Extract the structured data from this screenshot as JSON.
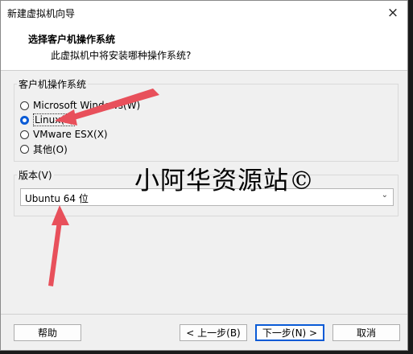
{
  "window": {
    "title": "新建虚拟机向导",
    "close_icon": "×"
  },
  "header": {
    "title": "选择客户机操作系统",
    "subtitle": "此虚拟机中将安装哪种操作系统?"
  },
  "os_group": {
    "label": "客户机操作系统",
    "options": [
      {
        "label": "Microsoft Windows(W)",
        "checked": false
      },
      {
        "label": "Linux(L)",
        "checked": true
      },
      {
        "label": "VMware ESX(X)",
        "checked": false
      },
      {
        "label": "其他(O)",
        "checked": false
      }
    ]
  },
  "version_group": {
    "label": "版本(V)",
    "selected": "Ubuntu 64 位"
  },
  "watermark": "小阿华资源站©",
  "buttons": {
    "help": "帮助",
    "back": "< 上一步(B)",
    "next": "下一步(N) >",
    "cancel": "取消"
  },
  "colors": {
    "accent": "#0a5bd6",
    "arrow": "#e8505b"
  }
}
